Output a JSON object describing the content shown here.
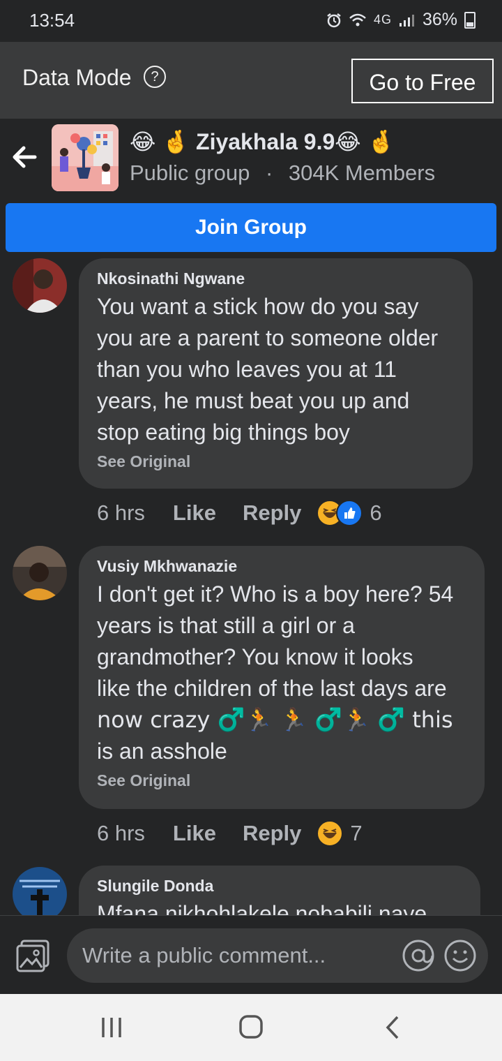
{
  "status_bar": {
    "time": "13:54",
    "battery": "36%",
    "network": "4G",
    "icons": [
      "alarm-icon",
      "wifi-icon",
      "signal-icon",
      "battery-icon"
    ]
  },
  "data_mode": {
    "label": "Data Mode",
    "help_symbol": "?",
    "free_button": "Go to Free"
  },
  "group": {
    "name": "Ziyakhala 9.9",
    "visibility": "Public group",
    "separator": "·",
    "members": "304K Members",
    "join_button": "Join Group"
  },
  "comments": [
    {
      "author": "Nkosinathi Ngwane",
      "text": "You want a stick how do you say you are a parent to someone older than you who leaves you at 11 years, he must beat you up and stop eating big things boy",
      "see_original": "See Original",
      "time": "6 hrs",
      "like": "Like",
      "reply": "Reply",
      "reactions": [
        "haha",
        "like"
      ],
      "reaction_count": "6"
    },
    {
      "author": "Vusiy Mkhwanazie",
      "text_lines": [
        "I don't get it? Who is a boy here? 54",
        "years is that still a girl or a",
        "grandmother? You know it looks",
        "like the children of the last days are",
        "now crazy ♂️🏃 🏃 ♂️🏃 ♂️ this",
        "is an asshole"
      ],
      "see_original": "See Original",
      "time": "6 hrs",
      "like": "Like",
      "reply": "Reply",
      "reactions": [
        "haha"
      ],
      "reaction_count": "7"
    },
    {
      "author": "Slungile Donda",
      "text": "Mfana nikhohlakele nobabili naye"
    }
  ],
  "composer": {
    "placeholder": "Write a public comment..."
  },
  "colors": {
    "background": "#242526",
    "bubble": "#3a3b3c",
    "accent": "#1877f2",
    "secondary_text": "#b0b3b8"
  }
}
